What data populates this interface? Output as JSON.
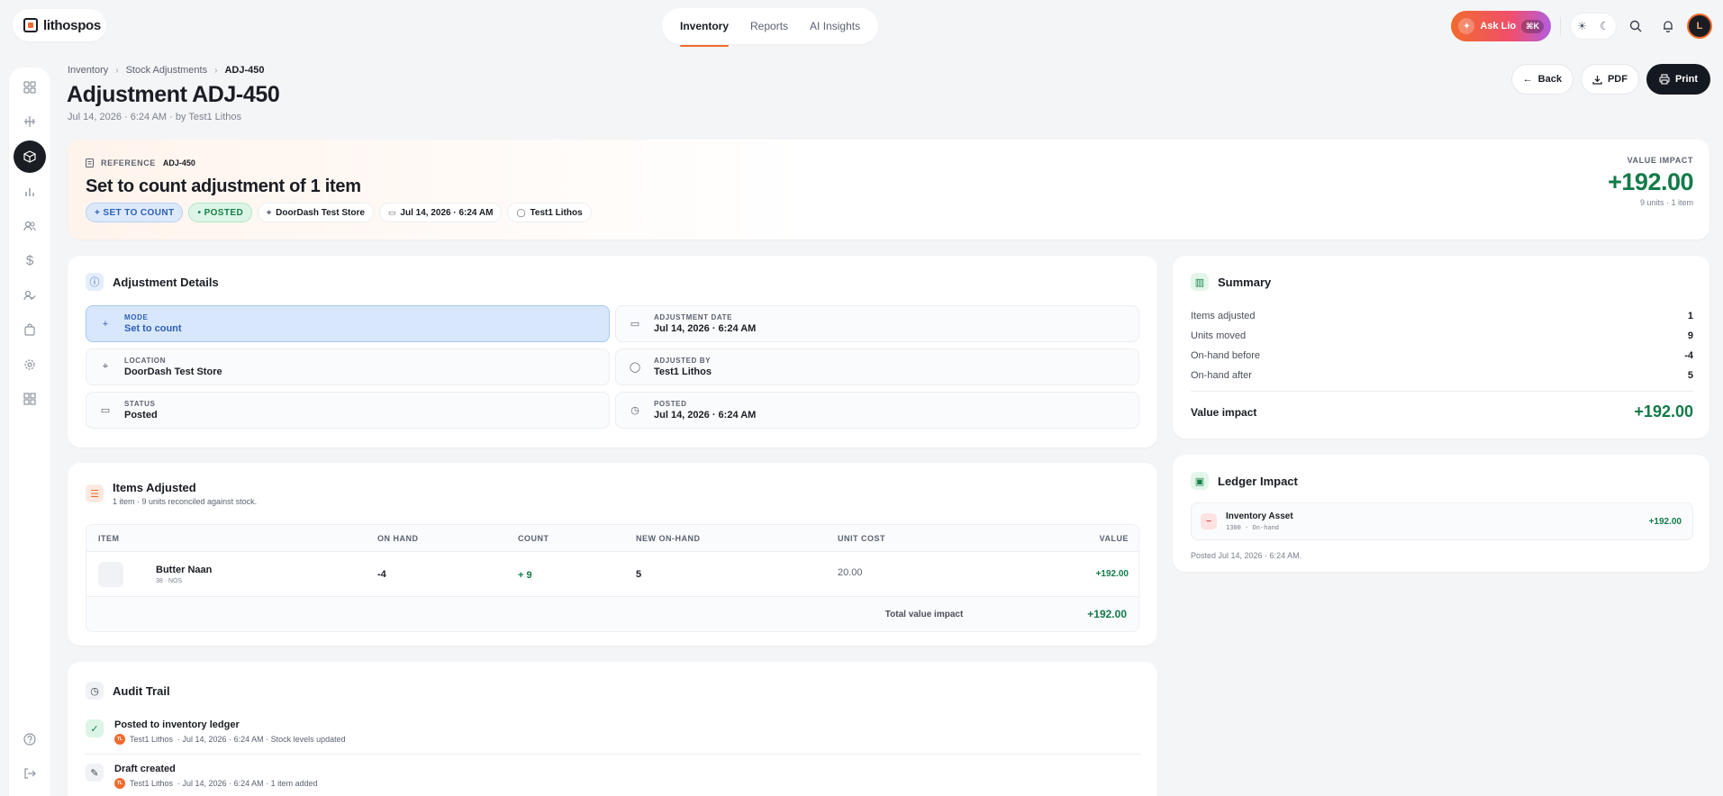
{
  "app": {
    "brand": "lithospos"
  },
  "topnav": {
    "tabs": [
      {
        "label": "Inventory",
        "active": true
      },
      {
        "label": "Reports",
        "active": false
      },
      {
        "label": "AI Insights",
        "active": false
      }
    ]
  },
  "topright": {
    "ask_label": "Ask Lio",
    "ask_shortcut": "⌘K",
    "avatar_initials": "L"
  },
  "breadcrumb": [
    "Inventory",
    "Stock Adjustments",
    "ADJ-450"
  ],
  "header": {
    "title": "Adjustment ADJ-450",
    "subtitle": "Jul 14, 2026 · 6:24 AM · by Test1 Lithos",
    "back": "Back",
    "pdf": "PDF",
    "print": "Print"
  },
  "hero": {
    "reference_label": "REFERENCE",
    "reference_value": "ADJ-450",
    "title": "Set to count adjustment of 1 item",
    "chips": {
      "mode": "+ SET TO COUNT",
      "status": "• POSTED",
      "location": "DoorDash Test Store",
      "date": "Jul 14, 2026 · 6:24 AM",
      "user": "Test1 Lithos"
    },
    "value_label": "VALUE IMPACT",
    "value": "+192.00",
    "value_sub": "9 units · 1 item"
  },
  "details": {
    "title": "Adjustment Details",
    "cells": [
      {
        "key": "MODE",
        "value": "Set to count"
      },
      {
        "key": "ADJUSTMENT DATE",
        "value": "Jul 14, 2026 · 6:24 AM"
      },
      {
        "key": "LOCATION",
        "value": "DoorDash Test Store"
      },
      {
        "key": "ADJUSTED BY",
        "value": "Test1 Lithos"
      },
      {
        "key": "STATUS",
        "value": "Posted"
      },
      {
        "key": "POSTED",
        "value": "Jul 14, 2026 · 6:24 AM"
      }
    ]
  },
  "items": {
    "title": "Items Adjusted",
    "subtitle": "1 item · 9 units reconciled against stock.",
    "columns": [
      "ITEM",
      "ON HAND",
      "COUNT",
      "NEW ON-HAND",
      "UNIT COST",
      "VALUE"
    ],
    "rows": [
      {
        "name": "Butter Naan",
        "meta": "38 · NOS",
        "on_hand": "-4",
        "count": "+ 9",
        "new_on_hand": "5",
        "unit_cost": "20.00",
        "value": "+192.00"
      }
    ],
    "total_label": "Total value impact",
    "total_value": "+192.00"
  },
  "summary": {
    "title": "Summary",
    "rows": [
      {
        "label": "Items adjusted",
        "value": "1"
      },
      {
        "label": "Units moved",
        "value": "9"
      },
      {
        "label": "On-hand before",
        "value": "-4"
      },
      {
        "label": "On-hand after",
        "value": "5"
      }
    ],
    "total_label": "Value impact",
    "total_value": "+192.00"
  },
  "ledger": {
    "title": "Ledger Impact",
    "account": "Inventory Asset",
    "account_meta": "1300 · On-hand",
    "amount": "+192.00",
    "note": "Posted Jul 14, 2026 · 6:24 AM."
  },
  "audit": {
    "title": "Audit Trail",
    "entries": [
      {
        "title": "Posted to inventory ledger",
        "user": "Test1 Lithos",
        "initials": "TL",
        "meta": "· Jul 14, 2026 · 6:24 AM · Stock levels updated"
      },
      {
        "title": "Draft created",
        "user": "Test1 Lithos",
        "initials": "TL",
        "meta": "· Jul 14, 2026 · 6:24 AM · 1 item added"
      }
    ]
  },
  "colors": {
    "accent": "#f26a2e",
    "positive": "#137a4a",
    "mode_blue": "#2d5fb8",
    "dark": "#141821"
  }
}
